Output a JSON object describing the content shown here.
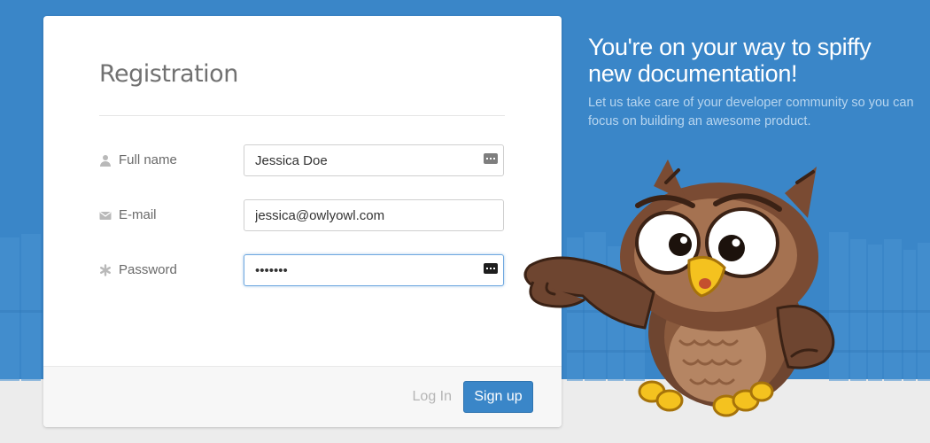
{
  "form": {
    "title": "Registration",
    "fields": [
      {
        "label": "Full name",
        "value": "Jessica Doe",
        "icon": "user-icon"
      },
      {
        "label": "E-mail",
        "value": "jessica@owlyowl.com",
        "icon": "envelope-icon"
      },
      {
        "label": "Password",
        "value": "•••••••",
        "icon": "asterisk-icon"
      }
    ],
    "login_label": "Log In",
    "signup_label": "Sign up"
  },
  "promo": {
    "headline": "You're on your way to spiffy new documentation!",
    "subtext": "Let us take care of your developer community so you can focus on building an awesome product."
  },
  "colors": {
    "brand_blue": "#3a86c8",
    "page_gray": "#ececec",
    "owl_brown": "#7a4b33"
  }
}
